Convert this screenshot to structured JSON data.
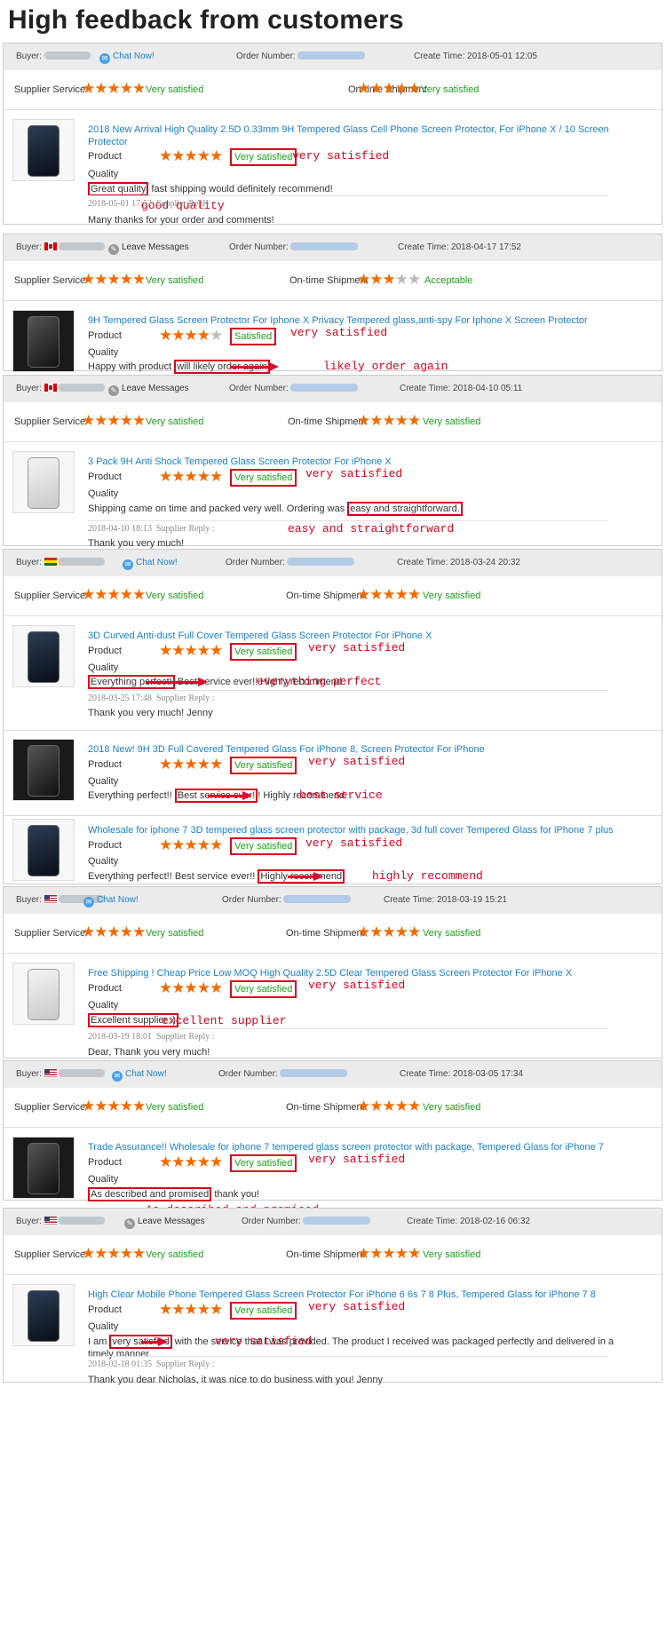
{
  "page_title": "High feedback from customers",
  "labels": {
    "buyer": "Buyer:",
    "order_number": "Order Number:",
    "create_time": "Create Time:",
    "supplier_service": "Supplier Service",
    "ontime_shipment": "On-time Shipment",
    "product": "Product",
    "quality": "Quality",
    "supplier_reply": "Supplier Reply :"
  },
  "colors": {
    "accent": "#1a7fc8",
    "status_green": "#1e9e1e",
    "star": "#f26a00",
    "annotation_red": "#d8001d"
  },
  "reviews": [
    {
      "buyer_flag": "",
      "buyer_action": "Chat Now!",
      "create_time": "2018-05-01 12:05",
      "supplier_service": {
        "stars": 5,
        "status": "Very satisfied"
      },
      "shipment": {
        "stars": 5,
        "status": "Very satisfied"
      },
      "products": [
        {
          "title": "2018 New Arrival High Quality 2.5D 0.33mm 9H Tempered Glass Cell Phone Screen Protector, For iPhone X / 10 Screen Protector",
          "stars": 5,
          "status": "Very satisfied",
          "status_note": "very satisfied",
          "fb_before": "",
          "fb_highlight": "Great quality",
          "fb_after": " fast shipping would definitely recommend!",
          "fb_note": "good quality",
          "reply_time": "2018-05-01 17:52",
          "reply": "Many thanks for your order and comments!"
        }
      ]
    },
    {
      "buyer_flag": "ca",
      "buyer_action": "Leave Messages",
      "create_time": "2018-04-17 17:52",
      "supplier_service": {
        "stars": 5,
        "status": "Very satisfied"
      },
      "shipment": {
        "stars": 3,
        "status": "Acceptable"
      },
      "products": [
        {
          "title": "9H Tempered Glass Screen Protector For Iphone X Privacy Tempered glass,anti-spy For Iphone X Screen Protector",
          "stars": 4,
          "status": "Satisfied",
          "status_note": "very satisfied",
          "fb_before": "Happy with product ",
          "fb_highlight": "will likely order again",
          "fb_after": "",
          "fb_note": "likely order again"
        }
      ]
    },
    {
      "buyer_flag": "ca",
      "buyer_action": "Leave Messages",
      "create_time": "2018-04-10 05:11",
      "supplier_service": {
        "stars": 5,
        "status": "Very satisfied"
      },
      "shipment": {
        "stars": 5,
        "status": "Very satisfied"
      },
      "products": [
        {
          "title": "3 Pack 9H Anti Shock Tempered Glass Screen Protector For iPhone X",
          "stars": 5,
          "status": "Very satisfied",
          "status_note": "very satisfied",
          "fb_before": "Shipping came on time and packed very well. Ordering was ",
          "fb_highlight": "easy and straightforward.",
          "fb_after": "",
          "fb_note": "easy and straightforward",
          "reply_time": "2018-04-10 18:13",
          "reply": "Thank you very much!"
        }
      ]
    },
    {
      "buyer_flag": "bo",
      "buyer_action": "Chat Now!",
      "create_time": "2018-03-24 20:32",
      "supplier_service": {
        "stars": 5,
        "status": "Very satisfied"
      },
      "shipment": {
        "stars": 5,
        "status": "Very satisfied"
      },
      "products": [
        {
          "title": "3D Curved Anti-dust Full Cover Tempered Glass Screen Protector For iPhone X",
          "stars": 5,
          "status": "Very satisfied",
          "status_note": "very satisfied",
          "fb_before": "",
          "fb_highlight": "Everything perfect!",
          "fb_after": " Best service ever!! Highly recommend",
          "fb_note": "everything perfect",
          "reply_time": "2018-03-25 17:48",
          "reply": "Thank you very much! Jenny"
        },
        {
          "title": "2018 New! 9H 3D Full Covered Tempered Glass For iPhone 8, Screen Protector For iPhone",
          "stars": 5,
          "status": "Very satisfied",
          "status_note": "very satisfied",
          "fb_before": "Everything perfect!! ",
          "fb_highlight": "Best service ever!",
          "fb_after": "! Highly recommend",
          "fb_note": "best service"
        },
        {
          "title": "Wholesale for iphone 7 3D tempered glass screen protector with package, 3d full cover Tempered Glass for iPhone 7 plus",
          "stars": 5,
          "status": "Very satisfied",
          "status_note": "very satisfied",
          "fb_before": "Everything perfect!! Best service ever!! ",
          "fb_highlight": "Highly recommend",
          "fb_after": "",
          "fb_note": "highly recommend"
        }
      ]
    },
    {
      "buyer_flag": "us",
      "buyer_action": "Chat Now!",
      "create_time": "2018-03-19 15:21",
      "supplier_service": {
        "stars": 5,
        "status": "Very satisfied"
      },
      "shipment": {
        "stars": 5,
        "status": "Very satisfied"
      },
      "products": [
        {
          "title": "Free Shipping ! Cheap Price Low MOQ High Quality 2.5D Clear Tempered Glass Screen Protector For iPhone X",
          "stars": 5,
          "status": "Very satisfied",
          "status_note": "very satisfied",
          "fb_before": "",
          "fb_highlight": "Excellent supplier :)",
          "fb_after": "",
          "fb_note": "excellent supplier",
          "reply_time": "2018-03-19 18:01",
          "reply": "Dear, Thank you very much!"
        }
      ]
    },
    {
      "buyer_flag": "us",
      "buyer_action": "Chat Now!",
      "create_time": "2018-03-05 17:34",
      "supplier_service": {
        "stars": 5,
        "status": "Very satisfied"
      },
      "shipment": {
        "stars": 5,
        "status": "Very satisfied"
      },
      "products": [
        {
          "title": "Trade Assurance!! Wholesale for iphone 7 tempered glass screen protector with package, Tempered Glass for iPhone 7",
          "stars": 5,
          "status": "Very satisfied",
          "status_note": "very satisfied",
          "fb_before": "",
          "fb_highlight": "As described and promised",
          "fb_after": " thank you!",
          "fb_note": "As described and promised"
        }
      ]
    },
    {
      "buyer_flag": "us",
      "buyer_action": "Leave Messages",
      "create_time": "2018-02-16 06:32",
      "supplier_service": {
        "stars": 5,
        "status": "Very satisfied"
      },
      "shipment": {
        "stars": 5,
        "status": "Very satisfied"
      },
      "products": [
        {
          "title": "High Clear Mobile Phone Tempered Glass Screen Protector For iPhone 6 6s 7 8 Plus, Tempered Glass for iPhone 7 8",
          "stars": 5,
          "status": "Very satisfied",
          "status_note": "very satisfied",
          "fb_before": "I am ",
          "fb_highlight": "very satisfied",
          "fb_after": " with the service that I was provided. The product I received was packaged perfectly and delivered in a timely manner.",
          "fb_note": "very satisfied",
          "reply_time": "2018-02-18 01:35",
          "reply": "Thank you dear Nicholas, it was nice to do business with you! Jenny"
        }
      ]
    }
  ]
}
